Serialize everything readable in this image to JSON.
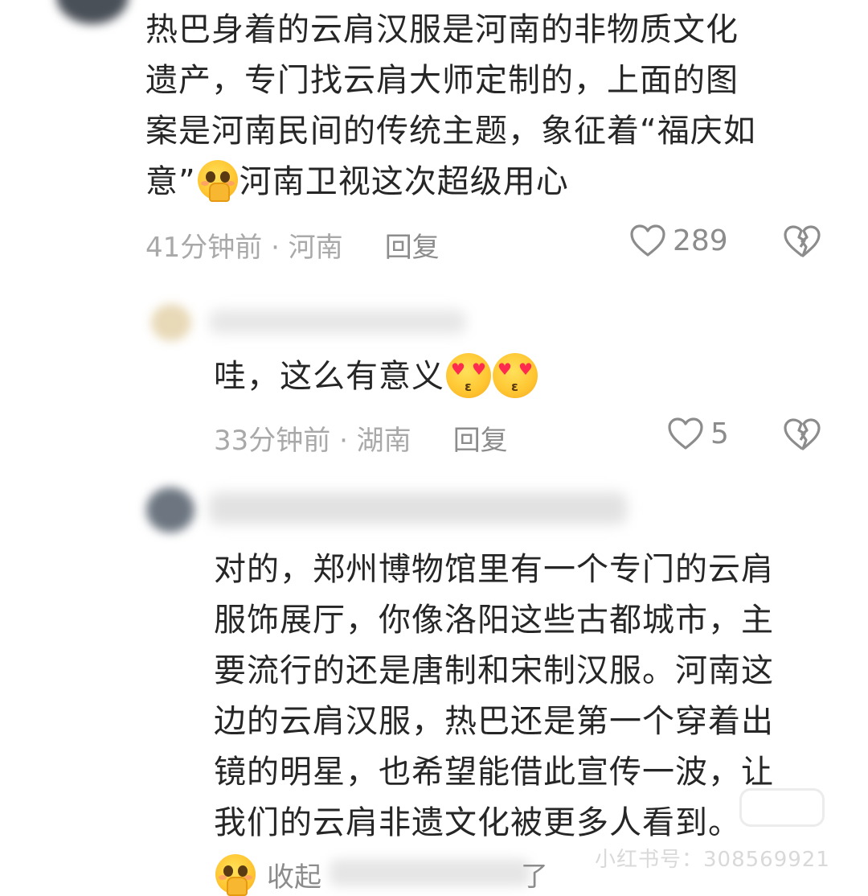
{
  "comments": [
    {
      "lines": [
        "热巴身着的云肩汉服是河南的非物质文化",
        "遗产，专门找云肩大师定制的，上面的图",
        "案是河南民间的传统主题，象征着“福庆如",
        "意”"
      ],
      "line4_tail": "河南卫视这次超级用心",
      "meta": "41分钟前 · 河南",
      "reply_label": "回复",
      "likes": "289"
    },
    {
      "text": "哇，这么有意义",
      "meta": "33分钟前 · 湖南",
      "reply_label": "回复",
      "likes": "5"
    },
    {
      "lines": [
        "对的，郑州博物馆里有一个专门的云肩",
        "服饰展厅，你像洛阳这些古都城市，主",
        "要流行的还是唐制和宋制汉服。河南这",
        "边的云肩汉服，热巴还是第一个穿着出",
        "镜的明星，也希望能借此宣传一波，让",
        "我们的云肩非遗文化被更多人看到。"
      ]
    }
  ],
  "collapse": {
    "label": "收起",
    "tail": "了"
  },
  "watermark": {
    "id_text": "小红书号：308569921",
    "logo_text": "小红书"
  },
  "colors": {
    "text": "#262626",
    "meta": "#a9a9a9",
    "icon": "#8c8c8c"
  },
  "icons": [
    "heart-icon",
    "broken-heart-icon",
    "hush-emoji",
    "heart-eyes-kiss-emoji"
  ]
}
